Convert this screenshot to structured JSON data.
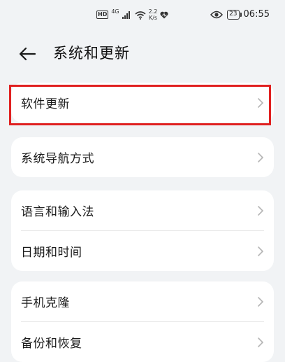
{
  "status_bar": {
    "hd_badge": "HD",
    "network": "4G",
    "speed_value": "2.2",
    "speed_unit": "K/s",
    "battery": "23",
    "time": "06:55",
    "icons": [
      "hd-icon",
      "signal-icon",
      "wifi-icon",
      "heart-icon",
      "eye-icon",
      "battery-icon"
    ]
  },
  "header": {
    "title": "系统和更新",
    "back_icon": "back-arrow-icon"
  },
  "groups": [
    {
      "items": [
        {
          "label": "软件更新"
        }
      ]
    },
    {
      "items": [
        {
          "label": "系统导航方式"
        }
      ]
    },
    {
      "items": [
        {
          "label": "语言和输入法"
        },
        {
          "label": "日期和时间"
        }
      ]
    },
    {
      "items": [
        {
          "label": "手机克隆"
        },
        {
          "label": "备份和恢复"
        }
      ]
    }
  ],
  "colors": {
    "background": "#f1f3f5",
    "card": "#ffffff",
    "highlight_border": "#e02020",
    "chevron": "#b5b5b5"
  }
}
